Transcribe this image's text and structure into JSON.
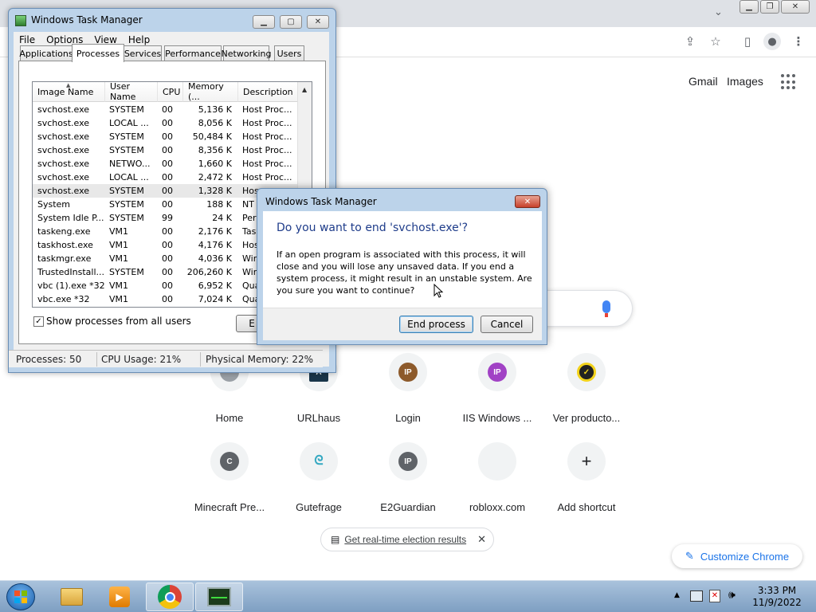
{
  "chrome": {
    "gmail": "Gmail",
    "images": "Images",
    "shortcuts": [
      {
        "label": "Home",
        "icon": "home-icon",
        "letter": "",
        "color": "#9aa0a6"
      },
      {
        "label": "URLhaus",
        "icon": "urlhaus-icon",
        "letter": "A",
        "color": "#19354a"
      },
      {
        "label": "Login",
        "icon": "ip-icon",
        "letter": "IP",
        "color": "#8d5a2b"
      },
      {
        "label": "IIS Windows ...",
        "icon": "ip-icon",
        "letter": "IP",
        "color": "#a142c5"
      },
      {
        "label": "Ver producto...",
        "icon": "check-icon",
        "letter": "✓",
        "color": "#f2d21b"
      },
      {
        "label": "Minecraft Pre...",
        "icon": "letter-icon",
        "letter": "C",
        "color": "#5f6368"
      },
      {
        "label": "Gutefrage",
        "icon": "gutefrage-icon",
        "letter": "ᘓ",
        "color": "#36a9c2"
      },
      {
        "label": "E2Guardian",
        "icon": "ip-icon",
        "letter": "IP",
        "color": "#5f6368"
      },
      {
        "label": "robloxx.com",
        "icon": "blank-icon",
        "letter": "",
        "color": "#f1f3f4"
      },
      {
        "label": "Add shortcut",
        "icon": "plus-icon",
        "letter": "+",
        "color": "#202124"
      }
    ],
    "election_link": "Get real-time election results",
    "customize": "Customize Chrome"
  },
  "taskmgr": {
    "title": "Windows Task Manager",
    "menu": [
      "File",
      "Options",
      "View",
      "Help"
    ],
    "tabs": [
      "Applications",
      "Processes",
      "Services",
      "Performance",
      "Networking",
      "Users"
    ],
    "active_tab": "Processes",
    "columns": [
      "Image Name",
      "User Name",
      "CPU",
      "Memory (...",
      "Description"
    ],
    "rows": [
      [
        "svchost.exe",
        "SYSTEM",
        "00",
        "5,136 K",
        "Host Proc..."
      ],
      [
        "svchost.exe",
        "LOCAL ...",
        "00",
        "8,056 K",
        "Host Proc..."
      ],
      [
        "svchost.exe",
        "SYSTEM",
        "00",
        "50,484 K",
        "Host Proc..."
      ],
      [
        "svchost.exe",
        "SYSTEM",
        "00",
        "8,356 K",
        "Host Proc..."
      ],
      [
        "svchost.exe",
        "NETWO...",
        "00",
        "1,660 K",
        "Host Proc..."
      ],
      [
        "svchost.exe",
        "LOCAL ...",
        "00",
        "2,472 K",
        "Host Proc..."
      ],
      [
        "svchost.exe",
        "SYSTEM",
        "00",
        "1,328 K",
        "Hos"
      ],
      [
        "System",
        "SYSTEM",
        "00",
        "188 K",
        "NT"
      ],
      [
        "System Idle P...",
        "SYSTEM",
        "99",
        "24 K",
        "Per"
      ],
      [
        "taskeng.exe",
        "VM1",
        "00",
        "2,176 K",
        "Tas"
      ],
      [
        "taskhost.exe",
        "VM1",
        "00",
        "4,176 K",
        "Hos"
      ],
      [
        "taskmgr.exe",
        "VM1",
        "00",
        "4,036 K",
        "Win"
      ],
      [
        "TrustedInstall...",
        "SYSTEM",
        "00",
        "206,260 K",
        "Win"
      ],
      [
        "vbc (1).exe *32",
        "VM1",
        "00",
        "6,952 K",
        "Qua"
      ],
      [
        "vbc.exe *32",
        "VM1",
        "00",
        "7,024 K",
        "Qua"
      ]
    ],
    "selected_row": 6,
    "show_all_label": "Show processes from all users",
    "show_all_checked": "✓",
    "end_btn_partial": "E",
    "status": {
      "processes": "Processes: 50",
      "cpu": "CPU Usage: 21%",
      "memory": "Physical Memory: 22%"
    }
  },
  "dialog": {
    "title": "Windows Task Manager",
    "heading": "Do you want to end 'svchost.exe'?",
    "message": "If an open program is associated with this process, it will close and you will lose any unsaved data. If you end a system process, it might result in an unstable system. Are you sure you want to continue?",
    "end_process": "End process",
    "cancel": "Cancel"
  },
  "taskbar": {
    "time": "3:33 PM",
    "date": "11/9/2022"
  }
}
